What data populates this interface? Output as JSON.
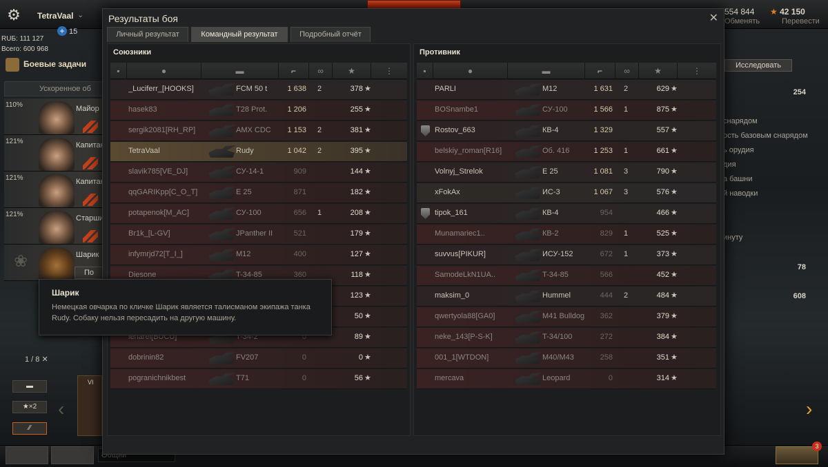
{
  "header": {
    "username": "TetraVaal",
    "plus_count": "15",
    "resources_rub": "RUБ: 111 127",
    "resources_total": "Всего: 600 968",
    "gold": "554 844",
    "gold_action": "Обменять",
    "free_xp": "42 150",
    "free_xp_action": "Перевести"
  },
  "left": {
    "tasks_label": "Боевые задачи",
    "accel_label": "Ускоренное об",
    "crew": [
      {
        "pct": "110%",
        "rank": "Майор"
      },
      {
        "pct": "121%",
        "rank": "Капитан"
      },
      {
        "pct": "121%",
        "rank": "Капитан"
      },
      {
        "pct": "121%",
        "rank": "Старший"
      },
      {
        "pct": "",
        "rank": "Шарик"
      }
    ],
    "dog_button": "По",
    "pager": "1 / 8",
    "carousel": {
      "tank_label": "VI",
      "x2_label": "×2"
    }
  },
  "tooltip": {
    "title": "Шарик",
    "text": "Немецкая овчарка по кличке Шарик является талисманом экипажа танка Rudy. Собаку нельзя пересадить на другую машину."
  },
  "right_side": {
    "research_button": "Исследовать",
    "val1": "254",
    "val2": "78",
    "val3": "608",
    "lines": [
      "снарядом",
      "ость базовым снарядом",
      "ь орудия",
      "дия",
      "а башни",
      "й наводки",
      "инуту"
    ]
  },
  "bottom": {
    "chat_placeholder": "Общий",
    "notif_count": "3"
  },
  "dialog": {
    "title": "Результаты боя",
    "tabs": [
      "Личный результат",
      "Командный результат",
      "Подробный отчёт"
    ],
    "active_tab": 1,
    "allies_title": "Союзники",
    "enemies_title": "Противник",
    "allies": [
      {
        "player": "_Luciferr_[HOOKS]",
        "tank": "FCM 50 t",
        "damage": "1 638",
        "kills": "2",
        "xp": "378",
        "dead": false
      },
      {
        "player": "hasek83",
        "tank": "T28 Prot.",
        "damage": "1 206",
        "kills": "",
        "xp": "255",
        "dead": true
      },
      {
        "player": "sergik2081[RH_RP]",
        "tank": "AMX CDC",
        "damage": "1 153",
        "kills": "2",
        "xp": "381",
        "dead": true
      },
      {
        "player": "TetraVaal",
        "tank": "Rudy",
        "damage": "1 042",
        "kills": "2",
        "xp": "395",
        "dead": false,
        "me": true
      },
      {
        "player": "slavik785[VE_DJ]",
        "tank": "СУ-14-1",
        "damage": "909",
        "kills": "",
        "xp": "144",
        "dead": true
      },
      {
        "player": "qqGARIKpp[C_O_T]",
        "tank": "E 25",
        "damage": "871",
        "kills": "",
        "xp": "182",
        "dead": true
      },
      {
        "player": "potapenok[M_AC]",
        "tank": "СУ-100",
        "damage": "656",
        "kills": "1",
        "xp": "208",
        "dead": true
      },
      {
        "player": "Br1k_[L-GV]",
        "tank": "JPanther II",
        "damage": "521",
        "kills": "",
        "xp": "179",
        "dead": true
      },
      {
        "player": "infymrjd72[T_I_]",
        "tank": "M12",
        "damage": "400",
        "kills": "",
        "xp": "127",
        "dead": true
      },
      {
        "player": "Diesone",
        "tank": "T-34-85",
        "damage": "360",
        "kills": "",
        "xp": "118",
        "dead": true
      },
      {
        "player": "",
        "tank": "",
        "damage": "",
        "kills": "",
        "xp": "123",
        "dead": true
      },
      {
        "player": "",
        "tank": "",
        "damage": "",
        "kills": "",
        "xp": "50",
        "dead": true
      },
      {
        "player": "lenarel[BUCU]",
        "tank": "T-34-2",
        "damage": "0",
        "kills": "",
        "xp": "89",
        "dead": true
      },
      {
        "player": "dobrinin82",
        "tank": "FV207",
        "damage": "0",
        "kills": "",
        "xp": "0",
        "dead": true
      },
      {
        "player": "pogranichnikbest",
        "tank": "T71",
        "damage": "0",
        "kills": "",
        "xp": "56",
        "dead": true
      }
    ],
    "enemies": [
      {
        "player": "PARLI",
        "tank": "M12",
        "damage": "1 631",
        "kills": "2",
        "xp": "629",
        "dead": false
      },
      {
        "player": "BOSnambe1",
        "tank": "СУ-100",
        "damage": "1 566",
        "kills": "1",
        "xp": "875",
        "dead": true
      },
      {
        "player": "Rostov_663",
        "tank": "КВ-4",
        "damage": "1 329",
        "kills": "",
        "xp": "557",
        "dead": false,
        "badge": true
      },
      {
        "player": "belskiy_roman[R16]",
        "tank": "Об. 416",
        "damage": "1 253",
        "kills": "1",
        "xp": "661",
        "dead": true
      },
      {
        "player": "Volnyj_Strelok",
        "tank": "E 25",
        "damage": "1 081",
        "kills": "3",
        "xp": "790",
        "dead": false
      },
      {
        "player": "xFokAx",
        "tank": "ИС-3",
        "damage": "1 067",
        "kills": "3",
        "xp": "576",
        "dead": false
      },
      {
        "player": "tipok_161",
        "tank": "КВ-4",
        "damage": "954",
        "kills": "",
        "xp": "466",
        "dead": false,
        "badge": true
      },
      {
        "player": "Munamariec1..",
        "tank": "КВ-2",
        "damage": "829",
        "kills": "1",
        "xp": "525",
        "dead": true
      },
      {
        "player": "suvvus[PIKUR]",
        "tank": "ИСУ-152",
        "damage": "672",
        "kills": "1",
        "xp": "373",
        "dead": false
      },
      {
        "player": "SamodeLkN1UA..",
        "tank": "T-34-85",
        "damage": "566",
        "kills": "",
        "xp": "452",
        "dead": true
      },
      {
        "player": "maksim_0",
        "tank": "Hummel",
        "damage": "444",
        "kills": "2",
        "xp": "484",
        "dead": false
      },
      {
        "player": "qwertyola88[GA0]",
        "tank": "M41 Bulldog",
        "damage": "362",
        "kills": "",
        "xp": "379",
        "dead": true
      },
      {
        "player": "neke_143[P-S-K]",
        "tank": "T-34/100",
        "damage": "272",
        "kills": "",
        "xp": "384",
        "dead": true
      },
      {
        "player": "001_1[WTDON]",
        "tank": "M40/M43",
        "damage": "258",
        "kills": "",
        "xp": "351",
        "dead": true
      },
      {
        "player": "mercava",
        "tank": "Leopard",
        "damage": "0",
        "kills": "",
        "xp": "314",
        "dead": true
      }
    ]
  }
}
